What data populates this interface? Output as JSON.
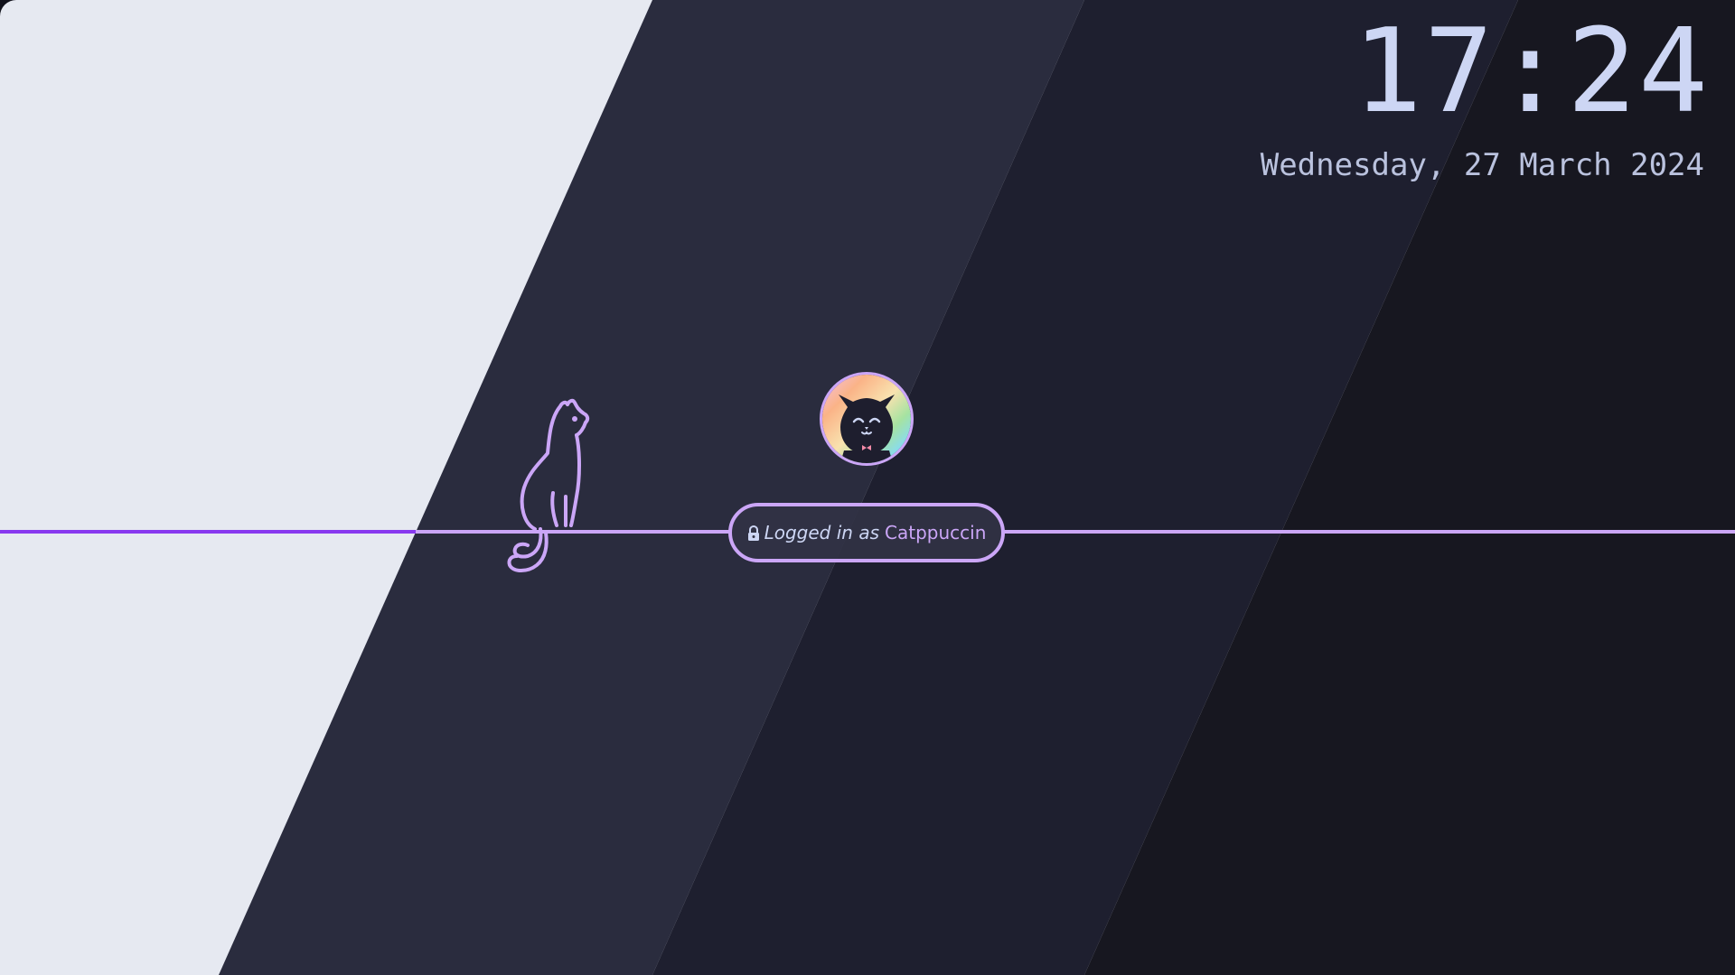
{
  "lockscreen": {
    "time": "17:24",
    "date": "Wednesday, 27 March 2024",
    "login": {
      "prefix": "Logged in as",
      "username": "Catppuccin"
    }
  },
  "icons": {
    "lock": "lock-icon",
    "avatar": "cat-avatar",
    "decoration": "sitting-cat-outline"
  },
  "colors": {
    "base": "#1e1e2e",
    "surface": "#313244",
    "text": "#cdd6f4",
    "subtext": "#bac2de",
    "accent_mauve": "#cba6f7",
    "line_purple": "#8839ef",
    "latte_base": "#e6e9f1",
    "crust": "#11111b"
  }
}
